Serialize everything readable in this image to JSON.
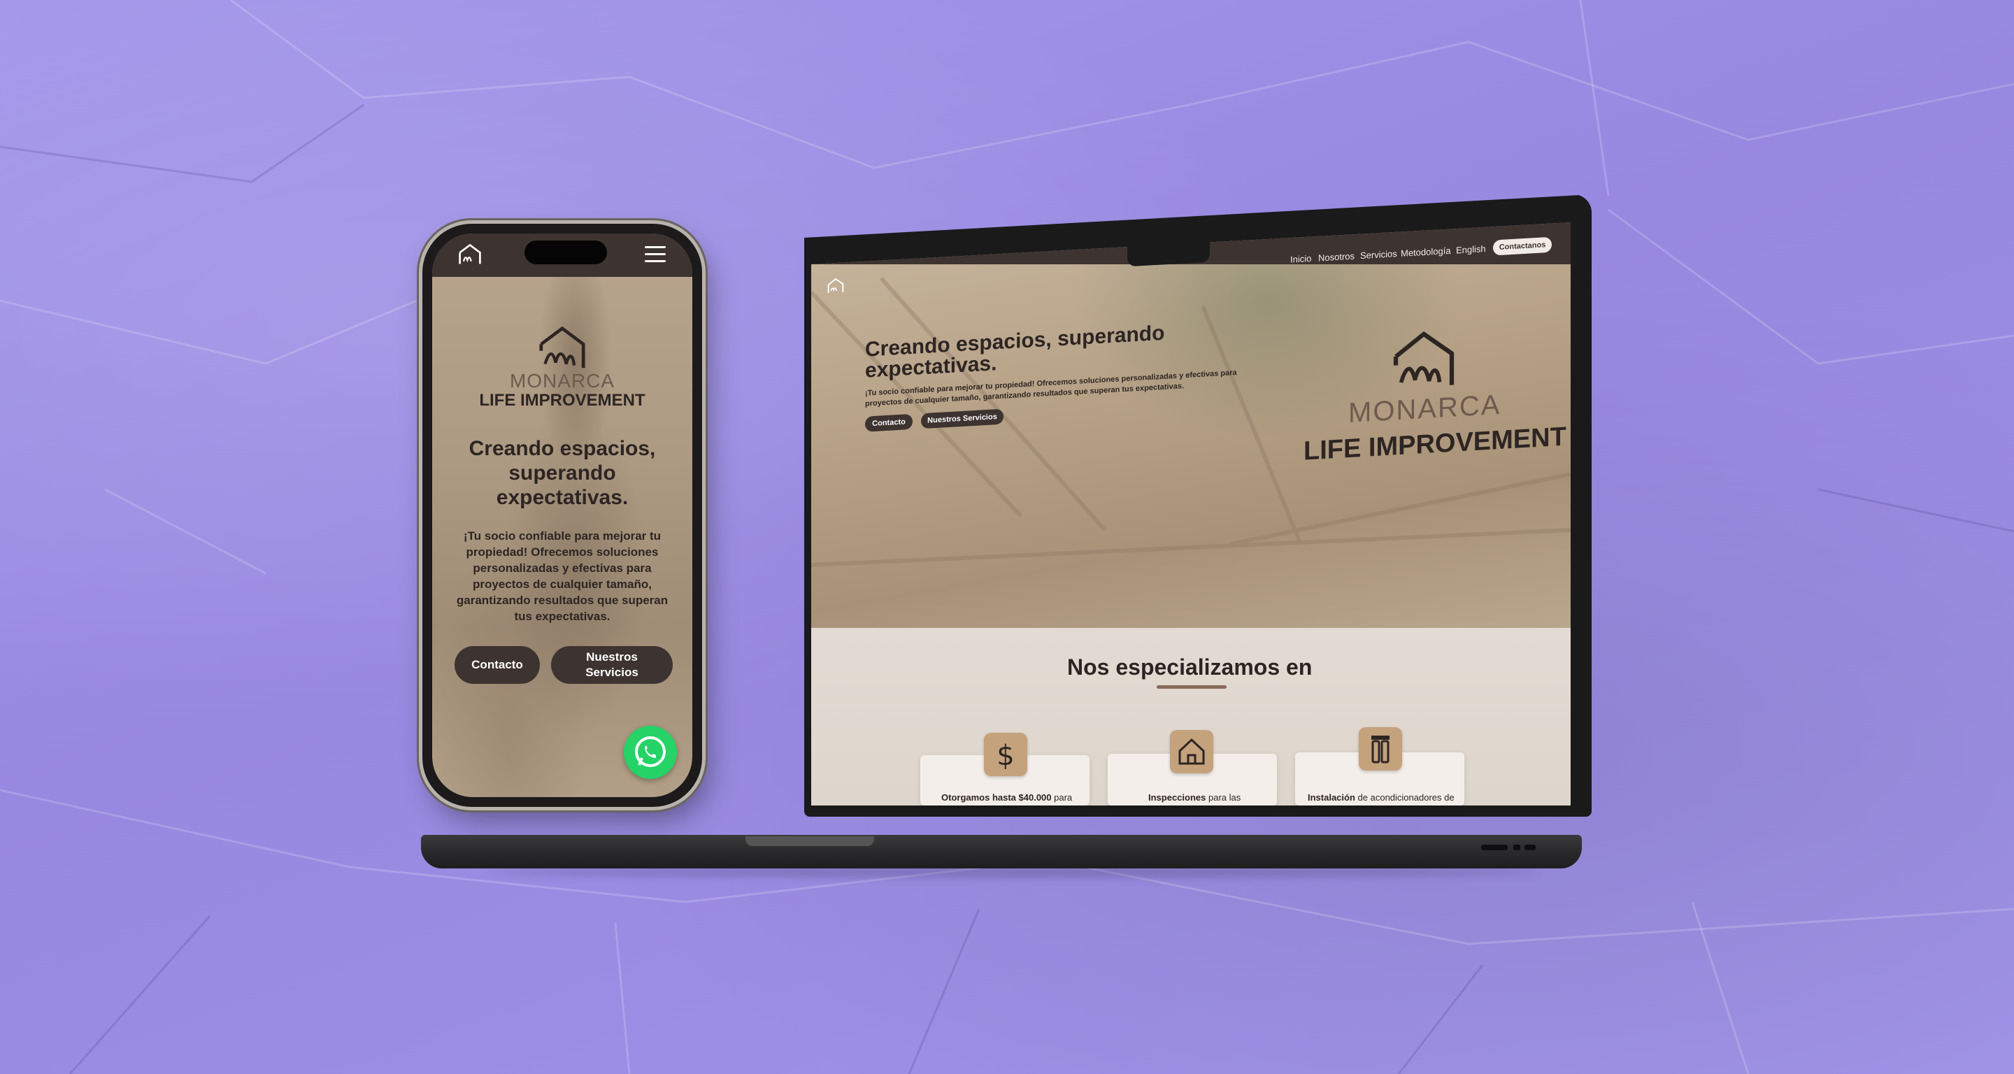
{
  "phone": {
    "brand_line1": "MONARCA",
    "brand_line2": "LIFE IMPROVEMENT",
    "headline": "Creando espacios, superando expectativas.",
    "subtext": "¡Tu socio confiable para mejorar tu propiedad! Ofrecemos soluciones personalizadas y efectivas para proyectos de cualquier tamaño, garantizando resultados que superan tus expectativas.",
    "button_contact": "Contacto",
    "button_services": "Nuestros Servicios",
    "icons": [
      "house-logo-icon",
      "hamburger-menu-icon",
      "whatsapp-icon"
    ]
  },
  "laptop": {
    "nav": {
      "items": [
        "Inicio",
        "Nosotros",
        "Servicios",
        "Metodología",
        "English"
      ],
      "contact_button": "Contactanos"
    },
    "hero": {
      "headline_line1": "Creando espacios, superando",
      "headline_line2": "expectativas.",
      "sub_line1": "¡Tu socio confiable para mejorar tu propiedad! Ofrecemos soluciones personalizadas y efectivas para",
      "sub_line2": "proyectos de cualquier tamaño, garantizando resultados que superan tus expectativas.",
      "button_contact": "Contacto",
      "button_services": "Nuestros Servicios",
      "brand_line1": "MONARCA",
      "brand_line2": "LIFE IMPROVEMENT"
    },
    "section_title": "Nos especializamos en",
    "cards": [
      {
        "icon": "dollar-icon",
        "bold": "Otorgamos hasta $40.000",
        "rest": " para"
      },
      {
        "icon": "house-icon",
        "bold": "Inspecciones",
        "rest": " para las"
      },
      {
        "icon": "air-conditioner-icon",
        "bold": "Instalación",
        "rest": " de acondicionadores de"
      }
    ]
  },
  "colors": {
    "background": "#9d8fe5",
    "brand_dark": "#3d3330",
    "hero_tint": "#b7a287",
    "accent_tan": "#c4a27c",
    "whatsapp_green": "#25d366"
  }
}
